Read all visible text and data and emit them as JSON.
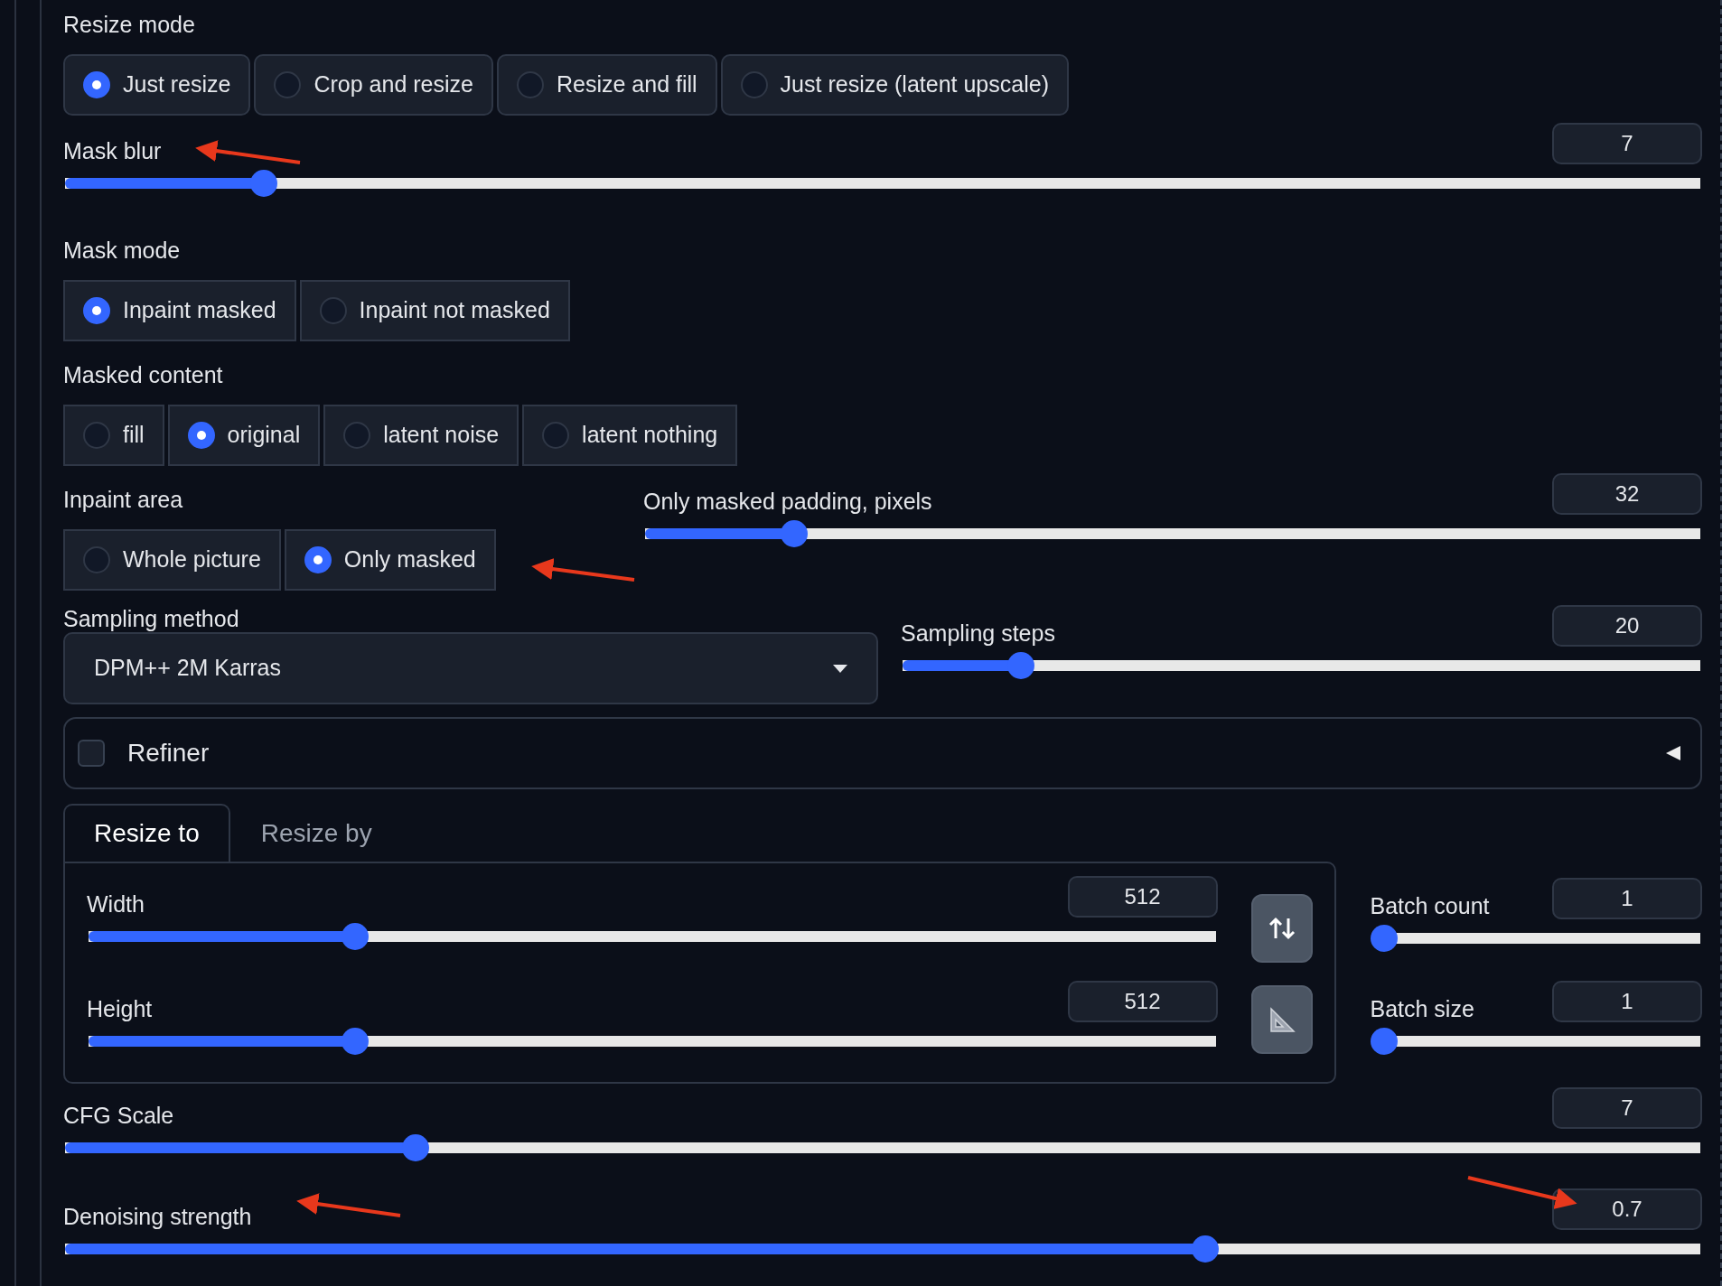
{
  "resize_mode": {
    "label": "Resize mode",
    "options": [
      {
        "label": "Just resize",
        "selected": true
      },
      {
        "label": "Crop and resize",
        "selected": false
      },
      {
        "label": "Resize and fill",
        "selected": false
      },
      {
        "label": "Just resize (latent upscale)",
        "selected": false
      }
    ]
  },
  "mask_blur": {
    "label": "Mask blur",
    "value": "7",
    "level": 0.116
  },
  "mask_mode": {
    "label": "Mask mode",
    "options": [
      {
        "label": "Inpaint masked",
        "selected": true
      },
      {
        "label": "Inpaint not masked",
        "selected": false
      }
    ]
  },
  "masked_content": {
    "label": "Masked content",
    "options": [
      {
        "label": "fill",
        "selected": false
      },
      {
        "label": "original",
        "selected": true
      },
      {
        "label": "latent noise",
        "selected": false
      },
      {
        "label": "latent nothing",
        "selected": false
      }
    ]
  },
  "inpaint_area": {
    "label": "Inpaint area",
    "options": [
      {
        "label": "Whole picture",
        "selected": false
      },
      {
        "label": "Only masked",
        "selected": true
      }
    ]
  },
  "only_masked_padding": {
    "label": "Only masked padding, pixels",
    "value": "32",
    "level": 0.133
  },
  "sampling_method": {
    "label": "Sampling method",
    "value": "DPM++ 2M Karras"
  },
  "sampling_steps": {
    "label": "Sampling steps",
    "value": "20",
    "level": 0.138
  },
  "refiner": {
    "label": "Refiner",
    "checked": false,
    "expanded": false
  },
  "size_tabs": [
    {
      "label": "Resize to",
      "selected": true
    },
    {
      "label": "Resize by",
      "selected": false
    }
  ],
  "width": {
    "label": "Width",
    "value": "512",
    "level": 0.231
  },
  "height": {
    "label": "Height",
    "value": "512",
    "level": 0.231
  },
  "batch_count": {
    "label": "Batch count",
    "value": "1",
    "level": 0
  },
  "batch_size": {
    "label": "Batch size",
    "value": "1",
    "level": 0
  },
  "cfg_scale": {
    "label": "CFG Scale",
    "value": "7",
    "level": 0.21
  },
  "denoising_strength": {
    "label": "Denoising strength",
    "value": "0.7",
    "level": 0.7
  }
}
